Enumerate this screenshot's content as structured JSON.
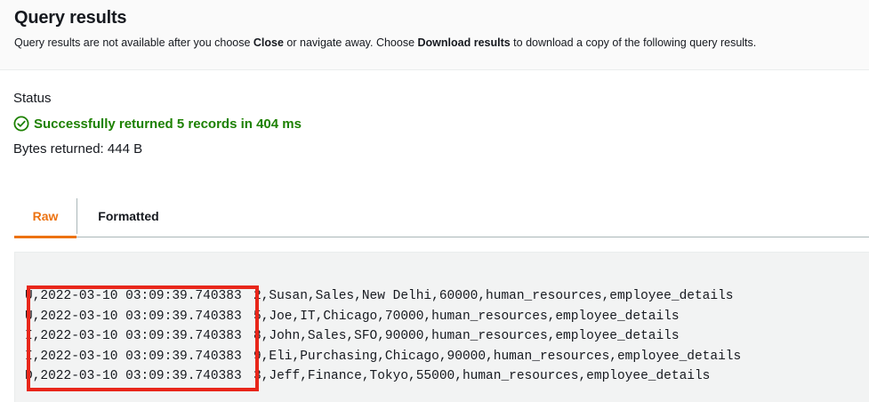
{
  "header": {
    "title": "Query results",
    "subtitle_part1": "Query results are not available after you choose ",
    "subtitle_close": "Close",
    "subtitle_part2": " or navigate away. Choose ",
    "subtitle_download": "Download results",
    "subtitle_part3": " to download a copy of the following query results."
  },
  "status": {
    "label": "Status",
    "icon": "check-circle-icon",
    "message": "Successfully returned 5 records in 404 ms",
    "bytes": "Bytes returned: 444 B",
    "success_color": "#1d8102"
  },
  "tabs": [
    {
      "label": "Raw",
      "active": true
    },
    {
      "label": "Formatted",
      "active": false
    }
  ],
  "results": {
    "rows": [
      {
        "meta": "U,2022-03-10 03:09:39.740383",
        "data": "2,Susan,Sales,New Delhi,60000,human_resources,employee_details"
      },
      {
        "meta": "U,2022-03-10 03:09:39.740383",
        "data": "5,Joe,IT,Chicago,70000,human_resources,employee_details"
      },
      {
        "meta": "I,2022-03-10 03:09:39.740383",
        "data": "8,John,Sales,SFO,90000,human_resources,employee_details"
      },
      {
        "meta": "I,2022-03-10 03:09:39.740383",
        "data": "9,Eli,Purchasing,Chicago,90000,human_resources,employee_details"
      },
      {
        "meta": "D,2022-03-10 03:09:39.740383",
        "data": "3,Jeff,Finance,Tokyo,55000,human_resources,employee_details"
      }
    ],
    "highlight_color": "#e8261a"
  },
  "colors": {
    "accent": "#ec7211",
    "text": "#16191f",
    "code_background": "#f2f3f3"
  }
}
